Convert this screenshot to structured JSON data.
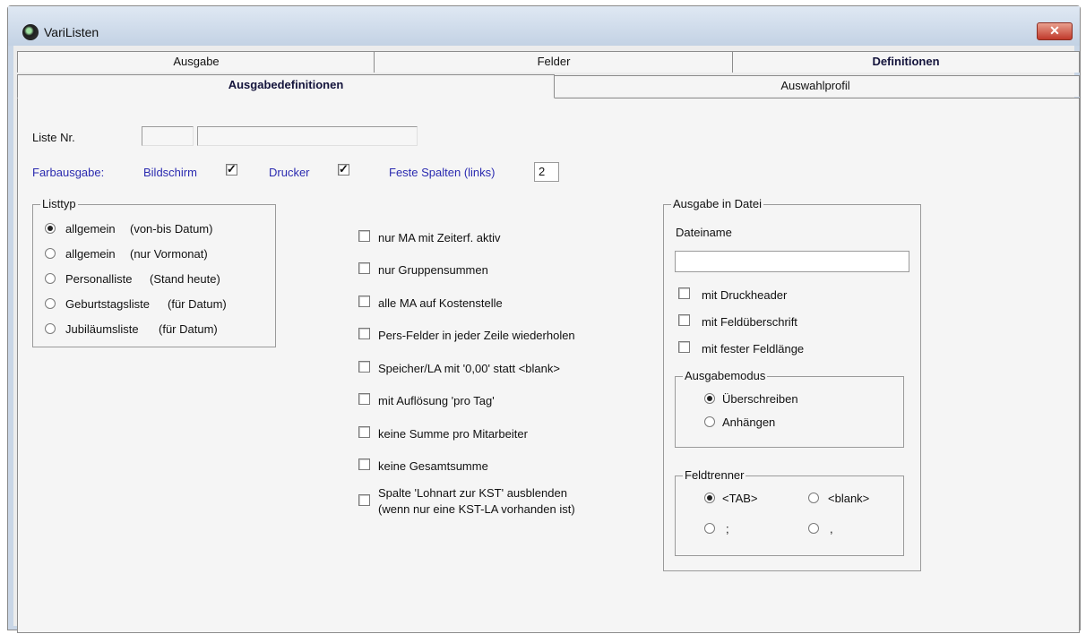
{
  "window": {
    "title": "VariListen",
    "close_symbol": "✕"
  },
  "tabs_row1": [
    {
      "label": "Ausgabe",
      "active": false
    },
    {
      "label": "Felder",
      "active": false
    },
    {
      "label": "Definitionen",
      "active": true
    }
  ],
  "tabs_row2": [
    {
      "label": "Ausgabedefinitionen",
      "active": true
    },
    {
      "label": "Auswahlprofil",
      "active": false
    }
  ],
  "liste": {
    "label": "Liste Nr.",
    "number_value": "",
    "name_value": ""
  },
  "farbausgabe": {
    "label": "Farbausgabe:",
    "bildschirm_label": "Bildschirm",
    "bildschirm_checked": true,
    "drucker_label": "Drucker",
    "drucker_checked": true,
    "feste_spalten_label": "Feste Spalten (links)",
    "feste_spalten_value": "2",
    "check_glyph": "✓"
  },
  "listtyp": {
    "legend": "Listtyp",
    "options": [
      {
        "label": "allgemein",
        "suffix": "(von-bis Datum)",
        "selected": true
      },
      {
        "label": "allgemein",
        "suffix": "(nur Vormonat)",
        "selected": false
      },
      {
        "label": "Personalliste",
        "suffix": "(Stand heute)",
        "selected": false
      },
      {
        "label": "Geburtstagsliste",
        "suffix": "(für Datum)",
        "selected": false
      },
      {
        "label": "Jubiläumsliste",
        "suffix": "(für Datum)",
        "selected": false
      }
    ]
  },
  "options": [
    {
      "label": "nur MA mit Zeiterf. aktiv",
      "checked": false
    },
    {
      "label": "nur Gruppensummen",
      "checked": false
    },
    {
      "label": "alle MA auf Kostenstelle",
      "checked": false
    },
    {
      "label": "Pers-Felder in jeder Zeile wiederholen",
      "checked": false
    },
    {
      "label": "Speicher/LA mit '0,00' statt <blank>",
      "checked": false
    },
    {
      "label": "mit Auflösung 'pro Tag'",
      "checked": false
    },
    {
      "label": "keine Summe pro Mitarbeiter",
      "checked": false
    },
    {
      "label": "keine Gesamtsumme",
      "checked": false
    },
    {
      "label": "Spalte 'Lohnart zur KST' ausblenden",
      "line2": "(wenn nur eine KST-LA vorhanden ist)",
      "checked": false
    }
  ],
  "ausgabe_datei": {
    "legend": "Ausgabe in Datei",
    "dateiname_label": "Dateiname",
    "dateiname_value": "",
    "checks": [
      {
        "label": "mit Druckheader",
        "checked": false
      },
      {
        "label": "mit Feldüberschrift",
        "checked": false
      },
      {
        "label": "mit fester Feldlänge",
        "checked": false
      }
    ],
    "ausgabemodus": {
      "legend": "Ausgabemodus",
      "options": [
        {
          "label": "Überschreiben",
          "selected": true
        },
        {
          "label": "Anhängen",
          "selected": false
        }
      ]
    },
    "feldtrenner": {
      "legend": "Feldtrenner",
      "options": [
        {
          "label": "<TAB>",
          "selected": true
        },
        {
          "label": "<blank>",
          "selected": false
        },
        {
          "label": ";",
          "selected": false
        },
        {
          "label": ",",
          "selected": false
        }
      ]
    }
  }
}
